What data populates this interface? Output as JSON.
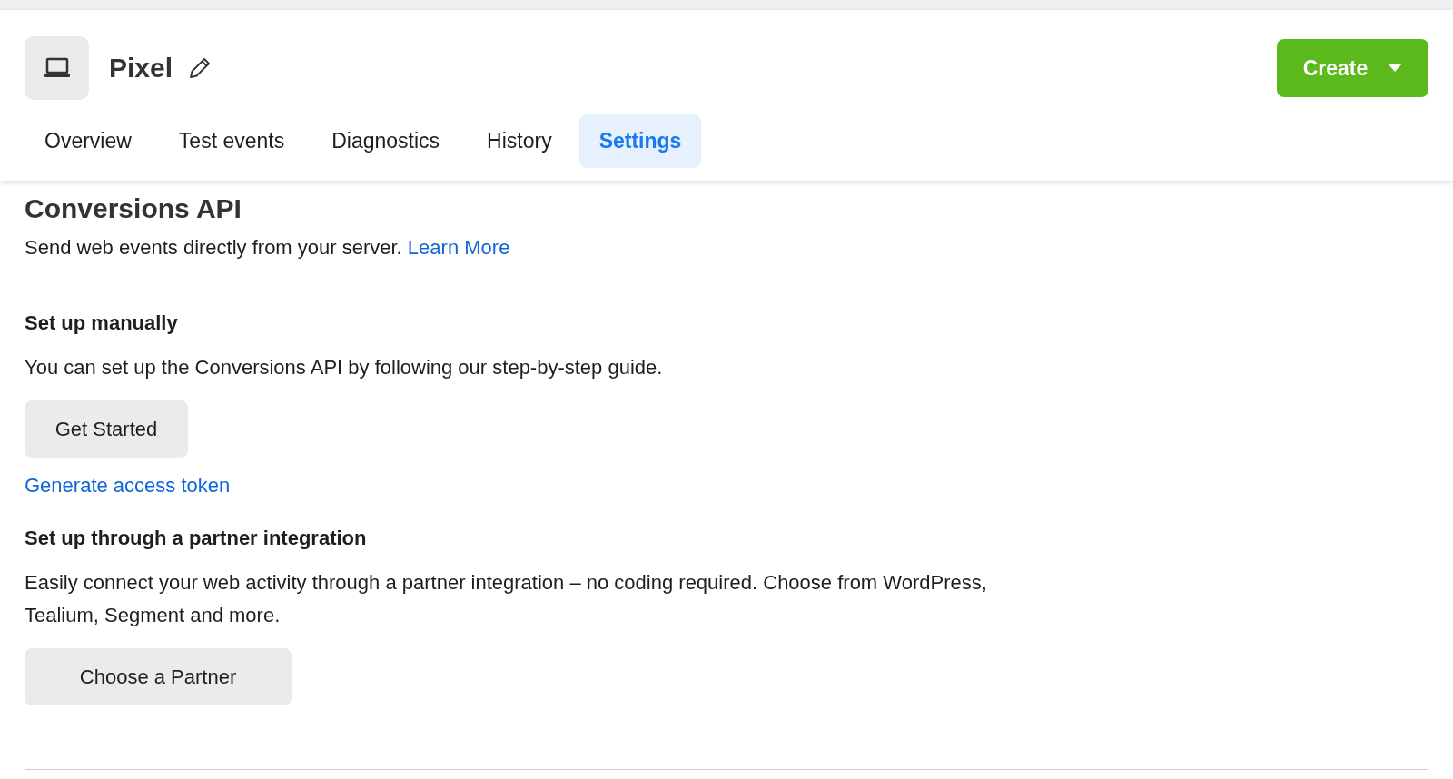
{
  "header": {
    "title": "Pixel",
    "create_button": "Create"
  },
  "tabs": [
    {
      "label": "Overview",
      "selected": false
    },
    {
      "label": "Test events",
      "selected": false
    },
    {
      "label": "Diagnostics",
      "selected": false
    },
    {
      "label": "History",
      "selected": false
    },
    {
      "label": "Settings",
      "selected": true
    }
  ],
  "section": {
    "title": "Conversions API",
    "intro": "Send web events directly from your server.",
    "intro_link": "Learn More",
    "manual": {
      "title": "Set up manually",
      "text": "You can set up the Conversions API by following our step-by-step guide.",
      "button": "Get Started",
      "link": "Generate access token"
    },
    "partner": {
      "title": "Set up through a partner integration",
      "text": "Easily connect your web activity through a partner integration – no coding required. Choose from WordPress, Tealium, Segment and more.",
      "button": "Choose a Partner"
    }
  }
}
